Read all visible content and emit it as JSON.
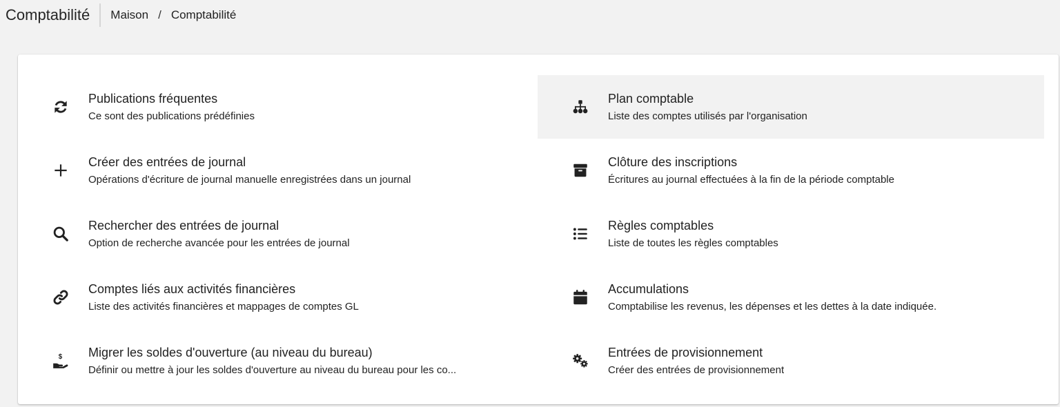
{
  "header": {
    "title": "Comptabilité",
    "breadcrumb": [
      "Maison",
      "/",
      "Comptabilité"
    ]
  },
  "colors": {
    "background": "#f2f2f2",
    "card": "#ffffff",
    "selected": "#f2f2f2",
    "text": "#212121"
  },
  "items": [
    {
      "title": "Publications fréquentes",
      "desc": "Ce sont des publications prédéfinies",
      "icon": "refresh-icon"
    },
    {
      "title": "Plan comptable",
      "desc": "Liste des comptes utilisés par l'organisation",
      "icon": "sitemap-icon",
      "selected": true
    },
    {
      "title": "Créer des entrées de journal",
      "desc": "Opérations d'écriture de journal manuelle enregistrées dans un journal",
      "icon": "plus-icon"
    },
    {
      "title": "Clôture des inscriptions",
      "desc": "Écritures au journal effectuées à la fin de la période comptable",
      "icon": "archive-icon"
    },
    {
      "title": "Rechercher des entrées de journal",
      "desc": "Option de recherche avancée pour les entrées de journal",
      "icon": "search-icon"
    },
    {
      "title": "Règles comptables",
      "desc": "Liste de toutes les règles comptables",
      "icon": "list-icon"
    },
    {
      "title": "Comptes liés aux activités financières",
      "desc": "Liste des activités financières et mappages de comptes GL",
      "icon": "link-icon"
    },
    {
      "title": "Accumulations",
      "desc": "Comptabilise les revenus, les dépenses et les dettes à la date indiquée.",
      "icon": "calendar-icon"
    },
    {
      "title": "Migrer les soldes d'ouverture (au niveau du bureau)",
      "desc": "Définir ou mettre à jour les soldes d'ouverture au niveau du bureau pour les co...",
      "icon": "hand-dollar-icon"
    },
    {
      "title": "Entrées de provisionnement",
      "desc": "Créer des entrées de provisionnement",
      "icon": "cogs-icon"
    }
  ]
}
